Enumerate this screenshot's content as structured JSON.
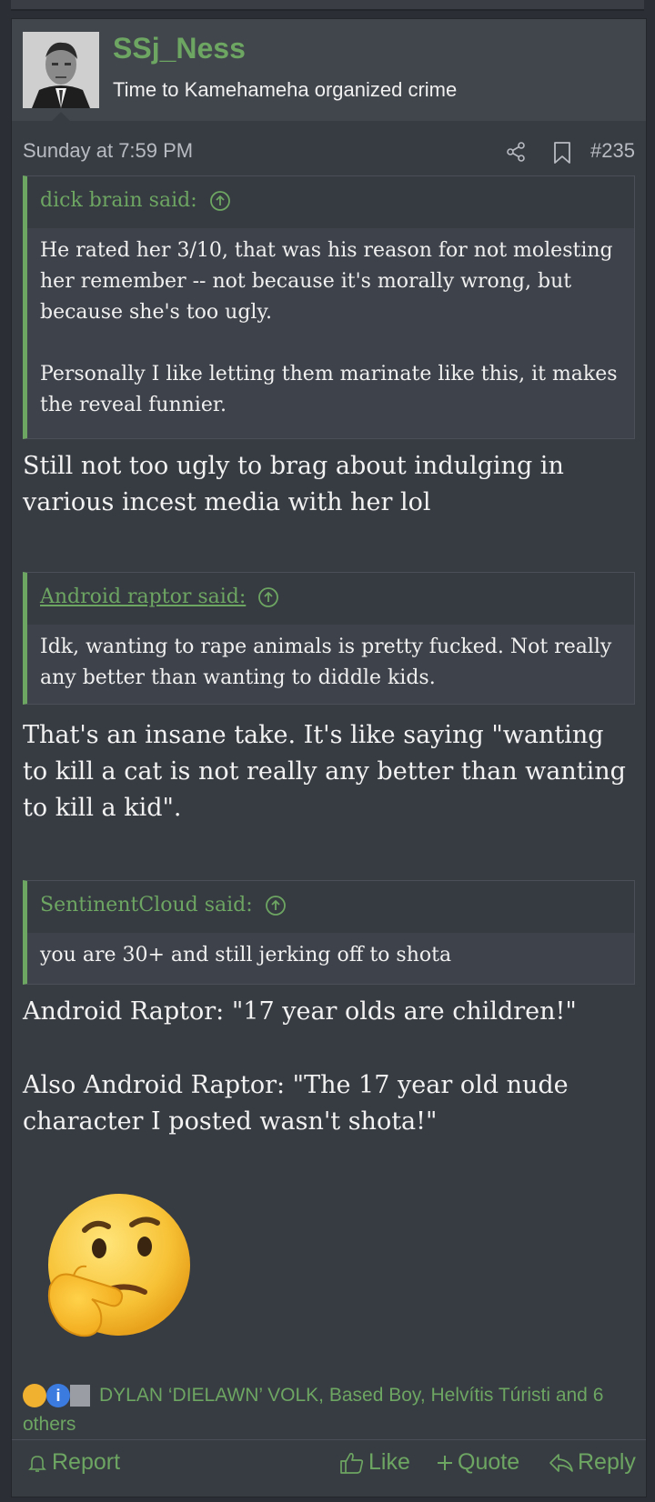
{
  "post": {
    "username": "SSj_Ness",
    "user_title": "Time to Kamehameha organized crime",
    "date": "Sunday at 7:59 PM",
    "post_number": "#235"
  },
  "quotes": [
    {
      "author_label": "dick brain said:",
      "body": [
        "He rated her 3/10, that was his reason for not molesting her remember -- not because it's morally wrong, but because she's too ugly.",
        "Personally I like letting them marinate like this, it makes the reveal funnier."
      ]
    },
    {
      "author_label": "Android raptor said:",
      "body": [
        "Idk, wanting to rape animals is pretty fucked. Not really any better than wanting to diddle kids."
      ]
    },
    {
      "author_label": "SentinentCloud said:",
      "body": [
        "you are 30+ and still jerking off to shota"
      ]
    }
  ],
  "replies": [
    "Still not too ugly to brag about indulging in various incest media with her lol",
    "That's an insane take. It's like saying \"wanting to kill a cat is not really any better than wanting to kill a kid\".",
    "Android Raptor: \"17 year olds are children!\"",
    "Also Android Raptor: \"The 17 year old nude character I posted wasn't shota!\""
  ],
  "emoji": "thinking-face",
  "reactions": {
    "text": "DYLAN ‘DIELAWN’ VOLK, Based Boy, Helvítis Túristi and 6 others",
    "icons": [
      "yawning-face-icon",
      "information-icon",
      "trash-can-icon"
    ]
  },
  "actions": {
    "report": "Report",
    "like": "Like",
    "quote": "Quote",
    "reply": "Reply"
  },
  "colors": {
    "accent": "#6da562",
    "background": "#2b2f35",
    "post_background": "#373b42"
  }
}
